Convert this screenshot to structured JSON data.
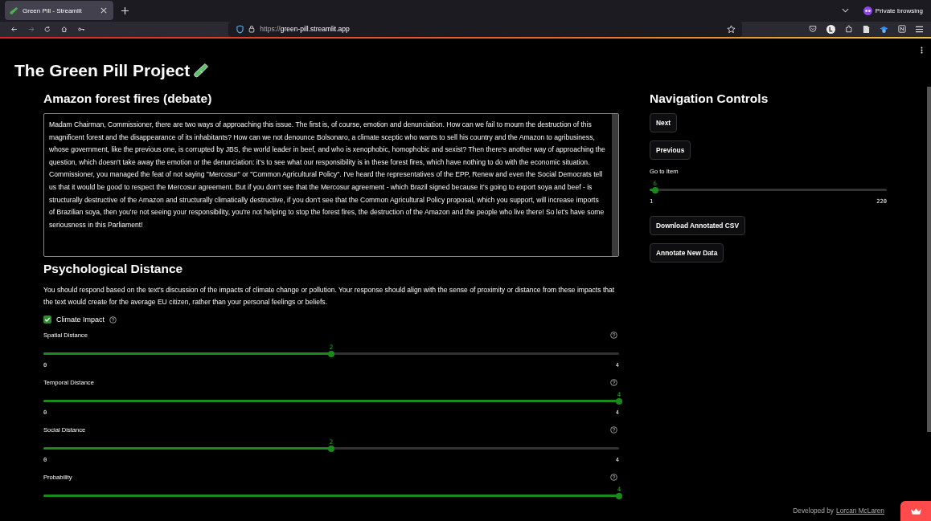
{
  "browser": {
    "tab": {
      "title": "Green Pill - Streamlit",
      "selected": true
    },
    "private_label": "Private browsing",
    "url_prefix": "https://",
    "url_domain": "green-pill.streamlit.app"
  },
  "page_title": "The Green Pill Project",
  "document": {
    "heading": "Amazon forest fires (debate)",
    "text": "Madam Chairman, Commissioner, there are two ways of approaching this issue. The first is, of course, emotion and denunciation. How can we fail to mourn the destruction of this magnificent forest and the disappearance of its inhabitants? How can we not denounce Bolsonaro, a climate sceptic who wants to sell his country and the Amazon to agribusiness, whose government, like the previous one, is corrupted by JBS, the world leader in beef, and who is xenophobic, homophobic and sexist? Then there's another way of approaching the question, which doesn't take away the emotion or the denunciation: it's to see what our responsibility is in these forest fires, which have nothing to do with the economic situation. Commissioner, you managed the feat of not saying \"Mercosur\" or \"Common Agricultural Policy\". I've heard the representatives of the EPP, Renew and even the Social Democrats tell us that it would be good to respect the Mercosur agreement. But if you don't see that the Mercosur agreement - which Brazil signed because it's going to export soya and beef - is structurally destructive of the Amazon and structurally climatically destructive, if you don't see that the Common Agricultural Policy proposal, which you support, will increase imports of Brazilian soya, then you're not seeing your responsibility, you're not helping to stop the forest fires, the destruction of the Amazon and the people who live there! So let's have some seriousness in this Parliament!"
  },
  "section": {
    "heading": "Psychological Distance",
    "instructions": "You should respond based on the text's discussion of the impacts of climate change or pollution. Your response should align with the sense of proximity or distance from these impacts that the text would create for the average EU citizen, rather than your personal feelings or beliefs.",
    "checkbox": {
      "label": "Climate Impact",
      "checked": true
    },
    "sliders": [
      {
        "label": "Spatial Distance",
        "value": "2",
        "level": 0.5,
        "min": "0",
        "max": "4"
      },
      {
        "label": "Temporal Distance",
        "value": "4",
        "level": 1,
        "min": "0",
        "max": "4"
      },
      {
        "label": "Social Distance",
        "value": "2",
        "level": 0.5,
        "min": "0",
        "max": "4"
      },
      {
        "label": "Probability",
        "value": "4",
        "level": 1
      }
    ]
  },
  "navigation": {
    "heading": "Navigation Controls",
    "buttons_top": [
      "Next",
      "Previous"
    ],
    "slider": {
      "label": "Go to Item",
      "value": "6",
      "level": 0.023,
      "min": "1",
      "max": "220"
    },
    "buttons_bottom": [
      "Download Annotated CSV",
      "Annotate New Data"
    ]
  },
  "footer": {
    "prefix": "Developed by",
    "link": "Lorcan McLaren"
  }
}
